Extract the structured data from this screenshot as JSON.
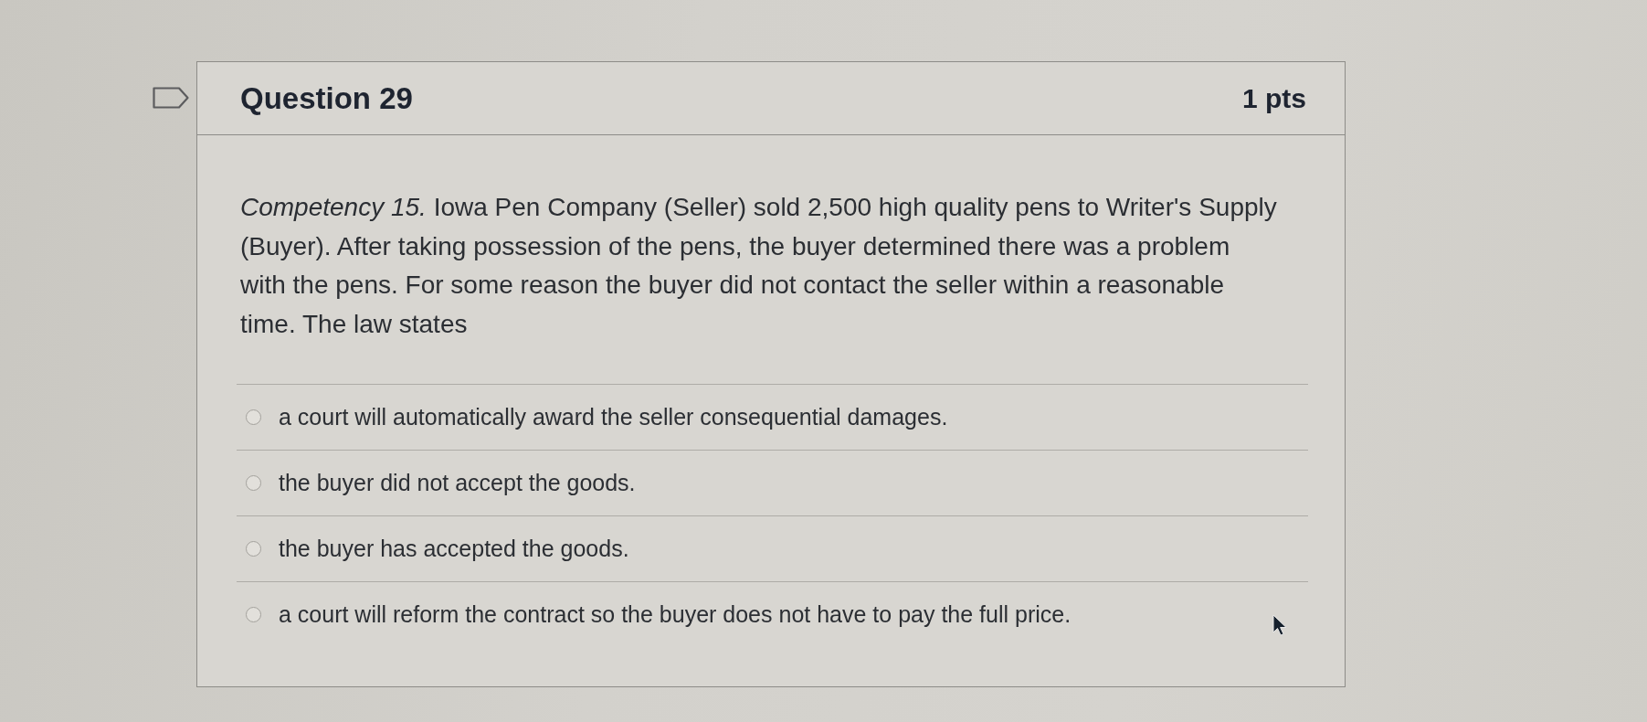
{
  "question": {
    "flagged": false,
    "title": "Question 29",
    "points": "1 pts",
    "text": "*Competency 15.* Iowa Pen Company (Seller) sold 2,500 high quality pens to Writer's Supply (Buyer). After taking possession of the pens, the buyer determined there was a problem with the pens. For some reason the buyer did not contact the seller within a reasonable time. The law states",
    "options": [
      {
        "label": "a court will automatically award the seller consequential damages.",
        "selected": false
      },
      {
        "label": "the buyer did not accept the goods.",
        "selected": false
      },
      {
        "label": "the buyer has accepted the goods.",
        "selected": false
      },
      {
        "label": "a court will reform the contract so the buyer does not have to pay the full price.",
        "selected": false
      }
    ]
  }
}
